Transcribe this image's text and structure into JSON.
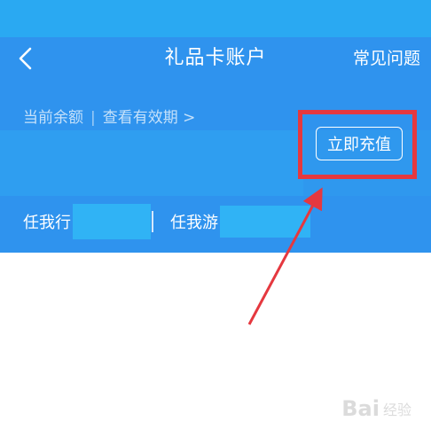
{
  "header": {
    "title": "礼品卡账户",
    "back_icon": "chevron-left-icon",
    "faq_label": "常见问题"
  },
  "balance": {
    "label": "当前余额",
    "separator": "|",
    "validity_link": "查看有效期 >"
  },
  "actions": {
    "recharge_label": "立即充值"
  },
  "cards": [
    {
      "name": "任我行"
    },
    {
      "name": "任我游"
    }
  ],
  "watermark": {
    "text": "Bai",
    "sub": "经验"
  },
  "colors": {
    "header_blue": "#2f93ee",
    "status_blue": "#2aa9f2",
    "highlight_red": "#e5383f",
    "arrow_red": "#e5383f"
  }
}
